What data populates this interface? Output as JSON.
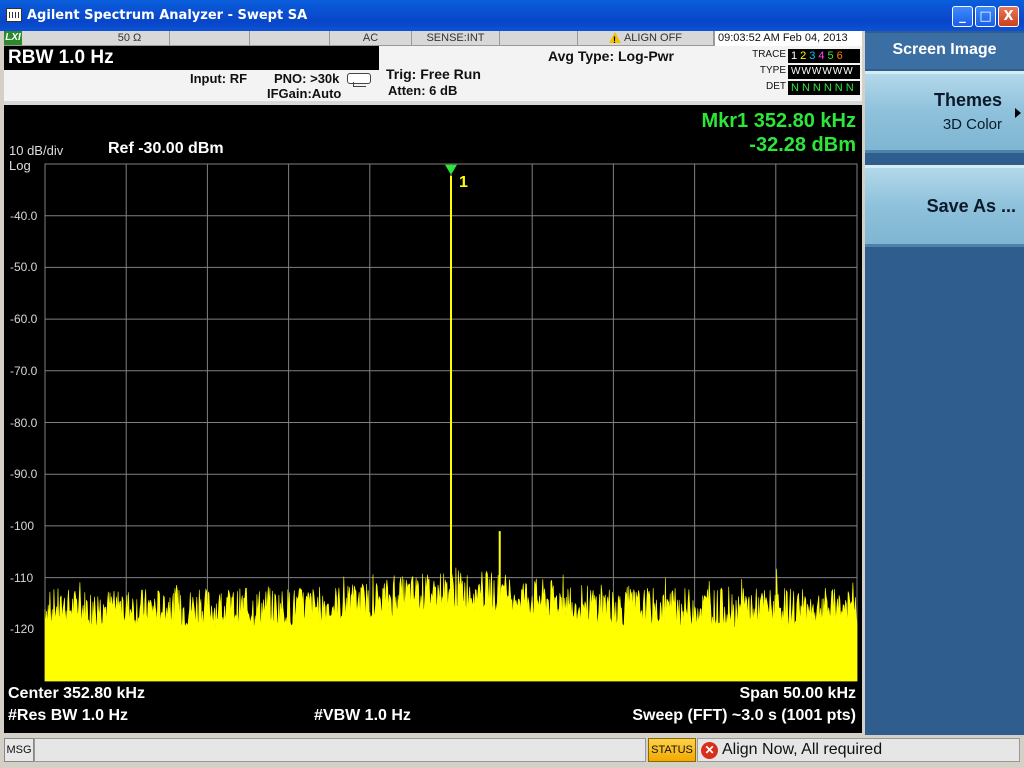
{
  "window": {
    "title": "Agilent Spectrum Analyzer - Swept SA",
    "minimize": "_",
    "maximize": "□",
    "close": "X"
  },
  "status_row": {
    "lxi": "LXI",
    "impedance": "50 Ω",
    "coupling": "AC",
    "sense": "SENSE:INT",
    "align": "ALIGN OFF",
    "datetime": "09:03:52 AM Feb 04, 2013"
  },
  "header": {
    "rbw": "RBW  1.0 Hz",
    "input": "Input: RF",
    "pno": "PNO: >30k",
    "ifgain": "IFGain:Auto",
    "trig": "Trig: Free Run",
    "atten": "Atten: 6 dB",
    "avg_type": "Avg Type: Log-Pwr",
    "trace_label": "TRACE",
    "type_label": "TYPE",
    "det_label": "DET",
    "trace_values": "123456",
    "type_values": "WWWWWW",
    "det_values": "NNNNNN"
  },
  "marker": {
    "line1": "Mkr1 352.80 kHz",
    "line2": "-32.28 dBm",
    "label": "1"
  },
  "scale": {
    "per_div": "10 dB/div",
    "log": "Log",
    "ref": "Ref -30.00 dBm"
  },
  "footer": {
    "center": "Center 352.80 kHz",
    "res_bw": "#Res BW 1.0 Hz",
    "vbw": "#VBW 1.0 Hz",
    "span": "Span 50.00 kHz",
    "sweep": "Sweep (FFT)  ~3.0 s (1001 pts)"
  },
  "softkeys": {
    "title": "Screen Image",
    "themes_label": "Themes",
    "themes_value": "3D Color",
    "save_as": "Save As ..."
  },
  "bottom": {
    "msg": "MSG",
    "status": "STATUS",
    "status_text": "Align Now, All required"
  },
  "colors": {
    "trace": "#ffff00",
    "marker": "#2ee63a",
    "grid": "#808080",
    "background": "#000000"
  },
  "chart_data": {
    "type": "line",
    "title": "",
    "xlabel": "",
    "ylabel": "",
    "x_range_khz": [
      327.8,
      377.8
    ],
    "ylim": [
      -130,
      -30
    ],
    "y_ticks": [
      "-40.0",
      "-50.0",
      "-60.0",
      "-70.0",
      "-80.0",
      "-90.0",
      "-100",
      "-110",
      "-120"
    ],
    "noise_floor_dbm": -116,
    "peaks": [
      {
        "freq_khz": 352.8,
        "level_dbm": -32.28
      },
      {
        "freq_khz": 355.8,
        "level_dbm": -101
      }
    ]
  }
}
